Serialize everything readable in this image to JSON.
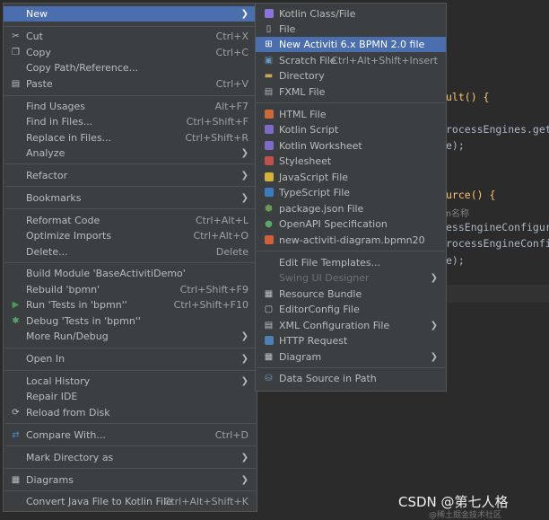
{
  "code": {
    "line1": "ult() {",
    "line2": "rocessEngines.getD",
    "line3": "e);",
    "line4": "urce() {",
    "line5": "n名称",
    "line6": "essEngineConfigura",
    "line7": "rocessEngineConfig",
    "line8": "e);"
  },
  "context_menu": {
    "new": "New",
    "cut": "Cut",
    "cut_sc": "Ctrl+X",
    "copy": "Copy",
    "copy_sc": "Ctrl+C",
    "copy_path": "Copy Path/Reference...",
    "paste": "Paste",
    "paste_sc": "Ctrl+V",
    "find_usages": "Find Usages",
    "find_usages_sc": "Alt+F7",
    "find_in_files": "Find in Files...",
    "find_in_files_sc": "Ctrl+Shift+F",
    "replace_in_files": "Replace in Files...",
    "replace_in_files_sc": "Ctrl+Shift+R",
    "analyze": "Analyze",
    "refactor": "Refactor",
    "bookmarks": "Bookmarks",
    "reformat": "Reformat Code",
    "reformat_sc": "Ctrl+Alt+L",
    "optimize": "Optimize Imports",
    "optimize_sc": "Ctrl+Alt+O",
    "delete": "Delete...",
    "delete_sc": "Delete",
    "build_module": "Build Module 'BaseActivitiDemo'",
    "rebuild": "Rebuild 'bpmn'",
    "rebuild_sc": "Ctrl+Shift+F9",
    "run_tests": "Run 'Tests in 'bpmn''",
    "run_tests_sc": "Ctrl+Shift+F10",
    "debug_tests": "Debug 'Tests in 'bpmn''",
    "more_run": "More Run/Debug",
    "open_in": "Open In",
    "local_history": "Local History",
    "repair_ide": "Repair IDE",
    "reload": "Reload from Disk",
    "compare": "Compare With...",
    "compare_sc": "Ctrl+D",
    "mark_dir": "Mark Directory as",
    "diagrams": "Diagrams",
    "convert": "Convert Java File to Kotlin File",
    "convert_sc": "Ctrl+Alt+Shift+K"
  },
  "new_submenu": {
    "kotlin_class": "Kotlin Class/File",
    "file": "File",
    "new_activiti": "New Activiti 6.x BPMN 2.0 file",
    "scratch": "Scratch File",
    "scratch_sc": "Ctrl+Alt+Shift+Insert",
    "directory": "Directory",
    "fxml": "FXML File",
    "html": "HTML File",
    "kotlin_script": "Kotlin Script",
    "kotlin_worksheet": "Kotlin Worksheet",
    "stylesheet": "Stylesheet",
    "javascript": "JavaScript File",
    "typescript": "TypeScript File",
    "package_json": "package.json File",
    "openapi": "OpenAPI Specification",
    "bpmn20": "new-activiti-diagram.bpmn20",
    "edit_templates": "Edit File Templates...",
    "swing": "Swing UI Designer",
    "resource_bundle": "Resource Bundle",
    "editorconfig": "EditorConfig File",
    "xml_config": "XML Configuration File",
    "http_request": "HTTP Request",
    "diagram": "Diagram",
    "data_source": "Data Source in Path"
  },
  "watermark": {
    "main": "CSDN @第七人格",
    "sub": "@稀土掘金技术社区"
  },
  "colors": {
    "menu_bg": "#3c3f41",
    "selection": "#4b6eaf",
    "editor_bg": "#2b2b2b"
  }
}
